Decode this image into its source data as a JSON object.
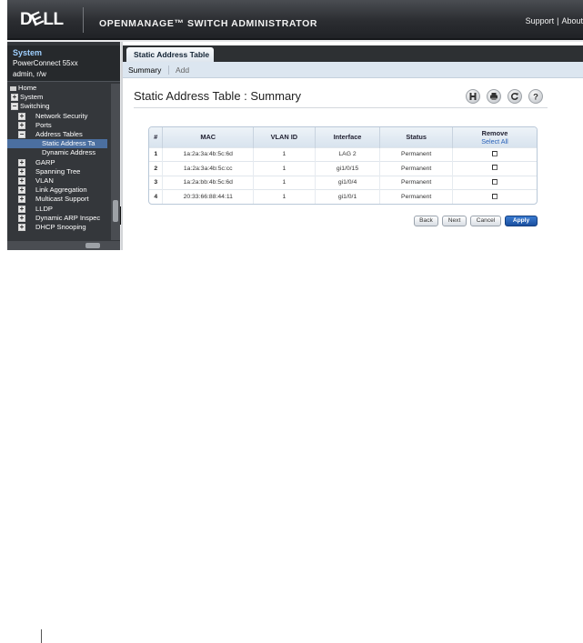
{
  "header": {
    "logo_text": "DELL",
    "app_title": "OPENMANAGE™ SWITCH ADMINISTRATOR",
    "links": [
      "Support",
      "About"
    ],
    "link_separator": "|"
  },
  "sidebar": {
    "system_title": "System",
    "model": "PowerConnect 55xx",
    "user": "admin, r/w",
    "tree": [
      {
        "label": "Home",
        "level": 0,
        "expander": "home"
      },
      {
        "label": "System",
        "level": 0,
        "expander": "+"
      },
      {
        "label": "Switching",
        "level": 0,
        "expander": "−"
      },
      {
        "label": "Network Security",
        "level": 1,
        "expander": "+"
      },
      {
        "label": "Ports",
        "level": 1,
        "expander": "+"
      },
      {
        "label": "Address Tables",
        "level": 1,
        "expander": "−"
      },
      {
        "label": "Static Address Ta",
        "level": 2,
        "expander": "",
        "selected": true
      },
      {
        "label": "Dynamic Address",
        "level": 2,
        "expander": ""
      },
      {
        "label": "GARP",
        "level": 1,
        "expander": "+"
      },
      {
        "label": "Spanning Tree",
        "level": 1,
        "expander": "+"
      },
      {
        "label": "VLAN",
        "level": 1,
        "expander": "+"
      },
      {
        "label": "Link Aggregation",
        "level": 1,
        "expander": "+"
      },
      {
        "label": "Multicast Support",
        "level": 1,
        "expander": "+"
      },
      {
        "label": "LLDP",
        "level": 1,
        "expander": "+"
      },
      {
        "label": "Dynamic ARP Inspec",
        "level": 1,
        "expander": "+"
      },
      {
        "label": "DHCP Snooping",
        "level": 1,
        "expander": "+"
      }
    ]
  },
  "content": {
    "tab_label": "Static Address Table",
    "subnav": {
      "active": "Summary",
      "other": "Add"
    },
    "page_title": "Static Address Table : Summary",
    "toolbar_icons": [
      "save-icon",
      "print-icon",
      "refresh-icon",
      "help-icon"
    ],
    "table": {
      "headers": [
        "#",
        "MAC",
        "VLAN ID",
        "Interface",
        "Status"
      ],
      "remove_header": "Remove",
      "select_all": "Select All",
      "rows": [
        {
          "n": "1",
          "mac": "1a:2a:3a:4b:5c:6d",
          "vlan": "1",
          "interface": "LAG 2",
          "status": "Permanent"
        },
        {
          "n": "2",
          "mac": "1a:2a:3a:4b:5c:cc",
          "vlan": "1",
          "interface": "gi1/0/15",
          "status": "Permanent"
        },
        {
          "n": "3",
          "mac": "1a:2a:bb:4b:5c:6d",
          "vlan": "1",
          "interface": "gi1/0/4",
          "status": "Permanent"
        },
        {
          "n": "4",
          "mac": "20:33:66:88:44:11",
          "vlan": "1",
          "interface": "gi1/0/1",
          "status": "Permanent"
        }
      ]
    },
    "buttons": {
      "back": "Back",
      "next": "Next",
      "cancel": "Cancel",
      "apply": "Apply"
    }
  }
}
